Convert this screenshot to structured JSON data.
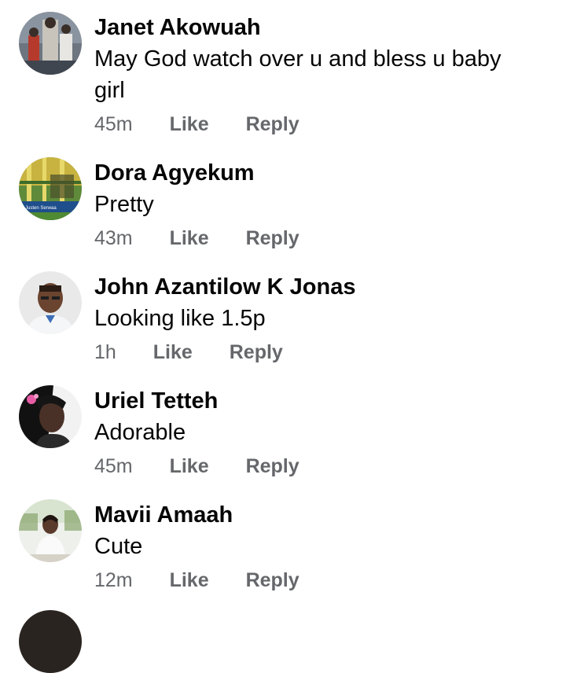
{
  "comments": [
    {
      "author": "Janet Akowuah",
      "text": "May God watch  over u and bless u baby girl",
      "time": "45m",
      "like_label": "Like",
      "reply_label": "Reply",
      "avatar_icon": "user-photo-janet"
    },
    {
      "author": "Dora Agyekum",
      "text": "Pretty",
      "time": "43m",
      "like_label": "Like",
      "reply_label": "Reply",
      "avatar_icon": "user-photo-dora",
      "avatar_caption": "Justen Serwaa"
    },
    {
      "author": "John Azantilow K Jonas",
      "text": "Looking like 1.5p",
      "time": "1h",
      "like_label": "Like",
      "reply_label": "Reply",
      "avatar_icon": "user-photo-john"
    },
    {
      "author": "Uriel Tetteh",
      "text": "Adorable",
      "time": "45m",
      "like_label": "Like",
      "reply_label": "Reply",
      "avatar_icon": "user-photo-uriel"
    },
    {
      "author": "Mavii Amaah",
      "text": "Cute",
      "time": "12m",
      "like_label": "Like",
      "reply_label": "Reply",
      "avatar_icon": "user-photo-mavii"
    }
  ],
  "colors": {
    "name_text": "#050505",
    "meta_text": "#65676b",
    "background": "#ffffff"
  }
}
